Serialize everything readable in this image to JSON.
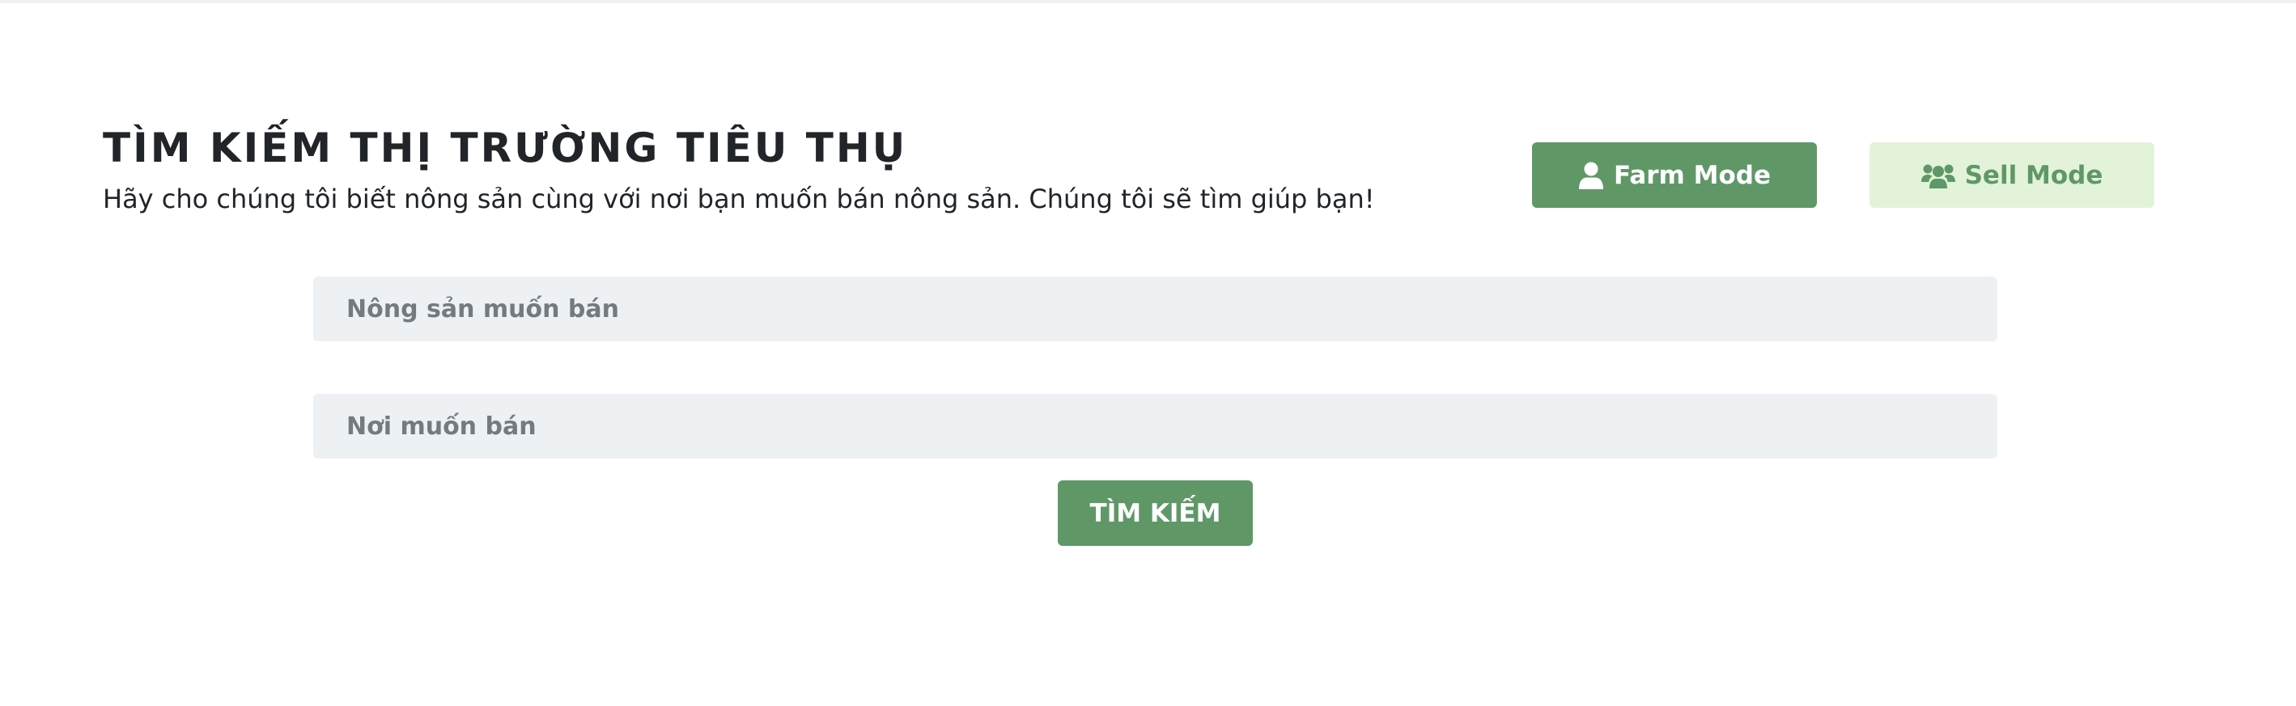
{
  "header": {
    "title": "TÌM KIẾM THỊ TRƯỜNG TIÊU THỤ",
    "subtitle": "Hãy cho chúng tôi biết nông sản cùng với nơi bạn muốn bán nông sản. Chúng tôi sẽ tìm giúp bạn!"
  },
  "modes": {
    "farm_label": "Farm Mode",
    "sell_label": "Sell Mode",
    "farm_icon": "user-icon",
    "sell_icon": "users-icon"
  },
  "form": {
    "product_placeholder": "Nông sản muốn bán",
    "product_value": "",
    "place_placeholder": "Nơi muốn bán",
    "place_value": "",
    "search_label": "TÌM KIẾM"
  },
  "colors": {
    "primary": "#5f9866",
    "primary_light": "#e2f3da",
    "field_bg": "#eef1f4",
    "text": "#212529"
  }
}
